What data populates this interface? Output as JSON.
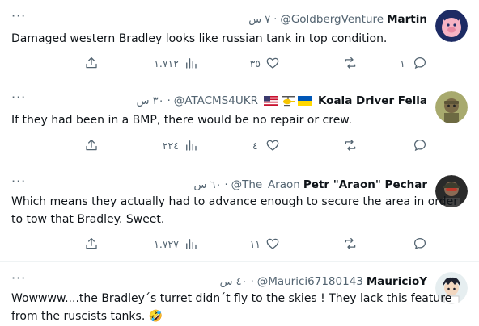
{
  "tweets": [
    {
      "display_name": "Martin",
      "handle": "@GoldbergVenture",
      "time": "٧ س",
      "text": "Damaged western Bradley looks like russian tank in top condition.",
      "views": "١.٧١٢",
      "likes": "٣٥",
      "retweets": "",
      "replies": "١",
      "avatar_icon": "pig-avatar-icon"
    },
    {
      "display_name": "Koala Driver Fella",
      "handle": "@ATACMS4UKR",
      "time": "٣٠ س",
      "text": "If they had been in a BMP, there would be no repair or crew.",
      "views": "٢٢٤",
      "likes": "٤",
      "retweets": "",
      "replies": "",
      "flags": [
        "us-flag-icon",
        "helicopter-icon",
        "ukraine-flag-icon"
      ],
      "avatar_icon": "koala-avatar-icon"
    },
    {
      "display_name": "Petr \"Araon\" Pechar",
      "handle": "@The_Araon",
      "time": "٦٠ س",
      "text": "Which means they actually had to advance enough to secure the area in order to tow that Bradley. Sweet.",
      "views": "١.٧٢٧",
      "likes": "١١",
      "retweets": "",
      "replies": "",
      "avatar_icon": "soldier-avatar-icon"
    },
    {
      "display_name": "MauricioY",
      "handle": "@Maurici67180143",
      "time": "٤٠ س",
      "text": "Wowwww....the Bradley´s turret didn´t fly to the skies ! They lack this feature from the ruscists tanks. 🤣",
      "views": "",
      "likes": "",
      "retweets": "",
      "replies": "",
      "avatar_icon": "anime-avatar-icon"
    }
  ],
  "ui": {
    "more_glyph": "···",
    "dot": "·"
  },
  "colors": {
    "text": "#0f1419",
    "muted": "#536471",
    "divider": "#eff3f4"
  }
}
